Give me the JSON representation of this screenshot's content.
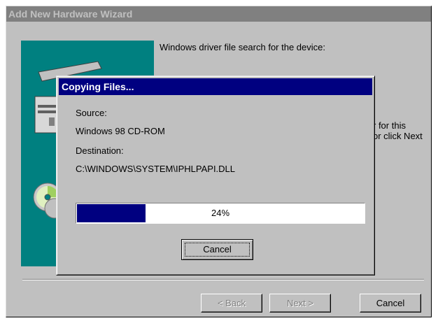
{
  "wizard": {
    "title": "Add New Hardware Wizard",
    "text_line1": "Windows driver file search for the device:",
    "partial_text": [
      "r for this",
      "or click Next"
    ],
    "buttons": {
      "back": "< Back",
      "next": "Next >",
      "cancel": "Cancel"
    }
  },
  "dialog": {
    "title": "Copying Files...",
    "source_label": "Source:",
    "source_value": "Windows 98 CD-ROM",
    "destination_label": "Destination:",
    "destination_value": "C:\\WINDOWS\\SYSTEM\\IPHLPAPI.DLL",
    "progress_percent": 24,
    "progress_text": "24%",
    "cancel_label": "Cancel"
  },
  "colors": {
    "title_active": "#000080",
    "title_inactive": "#808080",
    "face": "#c0c0c0",
    "picture_bg": "#008080"
  },
  "icons": [
    "computer-icon",
    "cd-disc-icon"
  ]
}
